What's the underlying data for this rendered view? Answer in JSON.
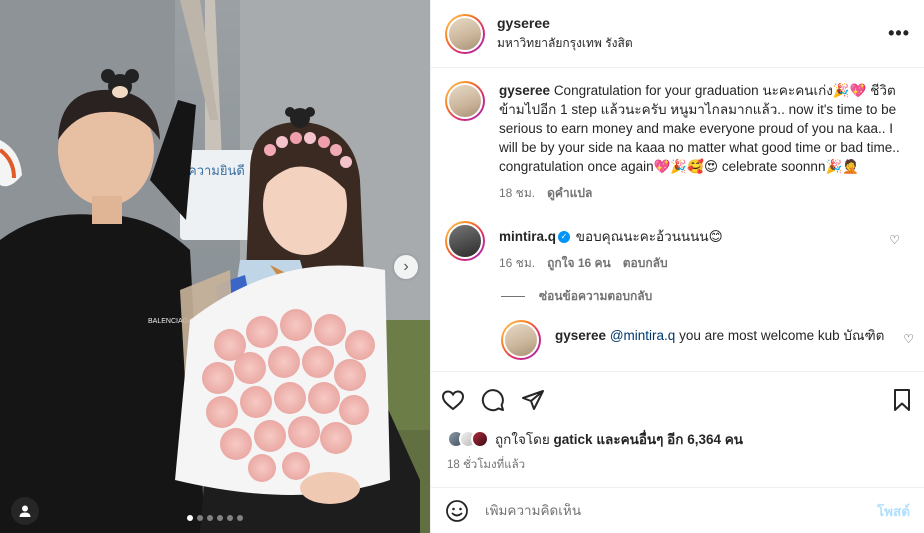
{
  "post": {
    "username": "gyseree",
    "location": "มหาวิทยาลัยกรุงเทพ รังสิต",
    "more_label": "•••"
  },
  "caption": {
    "username": "gyseree",
    "text": "Congratulation for your graduation นะคะคนเก่ง🎉💖 ชีวิตข้ามไปอีก 1 step แล้วนะครับ หนูมาไกลมากแล้ว.. now it's time to be serious to earn money and make everyone proud of you na kaa.. I will be by your side na kaaa no matter what good time or bad time.. congratulation once again💖🎉🥰😍 celebrate soonnn🎉🤦",
    "time": "18 ชม.",
    "translate": "ดูคำแปล"
  },
  "comments": [
    {
      "username": "mintira.q",
      "verified": true,
      "text": "ขอบคุณนะคะอ้วนนนน😊",
      "time": "16 ชม.",
      "likes": "ถูกใจ 16 คน",
      "reply": "ตอบกลับ"
    }
  ],
  "replies": {
    "toggle_label": "ซ่อนข้อความตอบกลับ",
    "items": [
      {
        "username": "gyseree",
        "mention": "@mintira.q",
        "text": "you are most welcome kub บัณฑิต"
      }
    ]
  },
  "likes": {
    "prefix": "ถูกใจโดย",
    "user": "gatick",
    "middle": "และคนอื่นๆ อีก",
    "count": "6,364",
    "suffix": "คน"
  },
  "time_ago": "18 ชั่วโมงที่แล้ว",
  "add_comment": {
    "placeholder": "เพิ่มความคิดเห็น",
    "post_label": "โพสต์"
  },
  "photo": {
    "shirt_text": "BALENCIAGA",
    "sign_text": "ความยินดี",
    "carousel_count": 6,
    "carousel_index": 0
  },
  "colors": {
    "accent": "#0095f6",
    "post_disabled": "#b2dffc",
    "secondary_text": "#737373"
  }
}
